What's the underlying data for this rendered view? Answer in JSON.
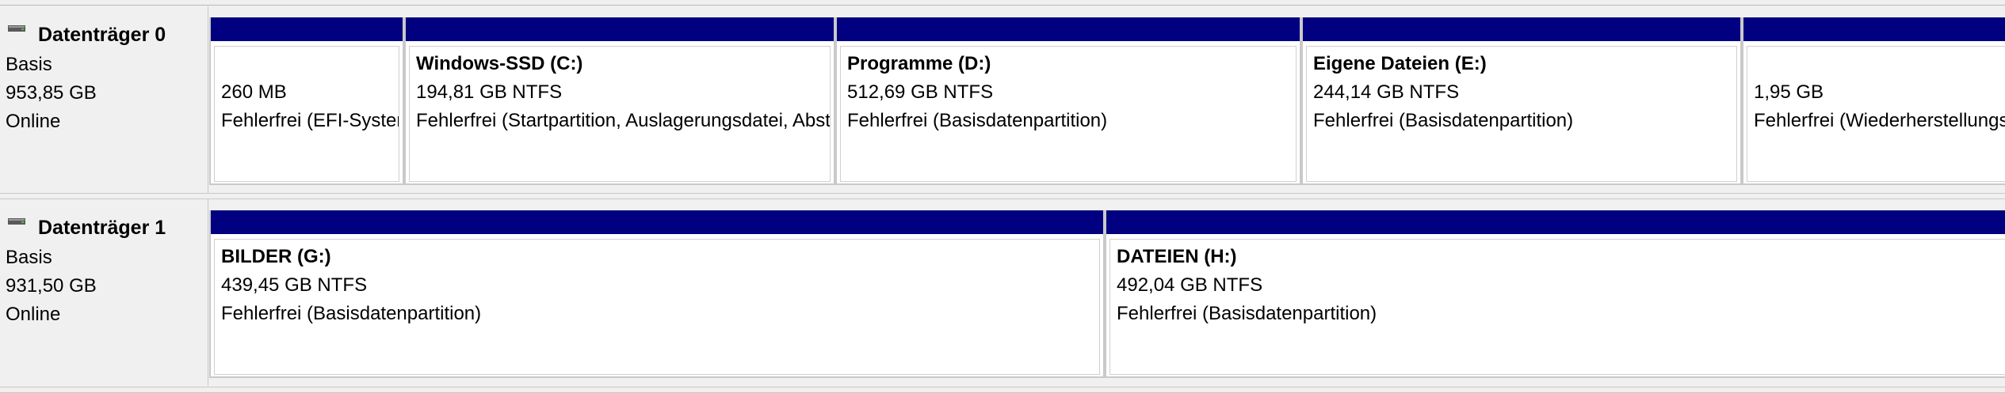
{
  "disks": [
    {
      "title": "Datenträger 0",
      "type": "Basis",
      "size": "953,85 GB",
      "status": "Online",
      "icon": "disk-icon",
      "partitions": [
        {
          "name": "",
          "size": "260 MB",
          "status": "Fehlerfrei (EFI-Systempartition)"
        },
        {
          "name": "Windows-SSD  (C:)",
          "size": "194,81 GB NTFS",
          "status": "Fehlerfrei (Startpartition, Auslagerungsdatei, Absturzabbild, Basisdatenpartition)"
        },
        {
          "name": "Programme  (D:)",
          "size": "512,69 GB NTFS",
          "status": "Fehlerfrei (Basisdatenpartition)"
        },
        {
          "name": "Eigene Dateien  (E:)",
          "size": "244,14 GB NTFS",
          "status": "Fehlerfrei (Basisdatenpartition)"
        },
        {
          "name": "",
          "size": "1,95 GB",
          "status": "Fehlerfrei (Wiederherstellungspartition)"
        }
      ]
    },
    {
      "title": "Datenträger 1",
      "type": "Basis",
      "size": "931,50 GB",
      "status": "Online",
      "icon": "disk-icon",
      "partitions": [
        {
          "name": "BILDER  (G:)",
          "size": "439,45 GB NTFS",
          "status": "Fehlerfrei (Basisdatenpartition)"
        },
        {
          "name": "DATEIEN  (H:)",
          "size": "492,04 GB NTFS",
          "status": "Fehlerfrei (Basisdatenpartition)"
        }
      ]
    }
  ],
  "colors": {
    "partition_header": "#000080",
    "background": "#f0f0f0",
    "partition_body": "#ffffff"
  }
}
